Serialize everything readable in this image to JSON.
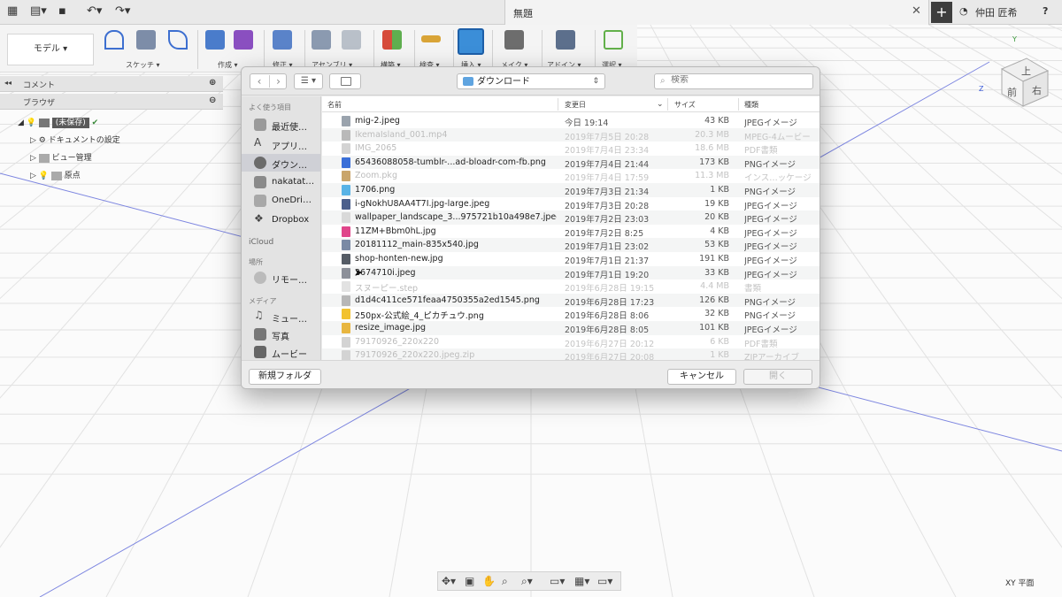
{
  "titlebar": {
    "doc_title": "無題",
    "user": "仲田 匠希",
    "plus": "+",
    "help": "?",
    "close": "✕"
  },
  "toolbar": {
    "model_label": "モデル ▾",
    "groups": [
      {
        "label": "スケッチ ▾"
      },
      {
        "label": "作成 ▾"
      },
      {
        "label": "修正 ▾"
      },
      {
        "label": "アセンブリ ▾"
      },
      {
        "label": "構築 ▾"
      },
      {
        "label": "検査 ▾"
      },
      {
        "label": "挿入 ▾"
      },
      {
        "label": "メイク ▾"
      },
      {
        "label": "アドイン ▾"
      },
      {
        "label": "選択 ▾"
      }
    ]
  },
  "panel": {
    "comments": "コメント",
    "browser": "ブラウザ",
    "tree": {
      "root": "(未保存)",
      "doc_settings": "ドキュメントの設定",
      "named_views": "ビュー管理",
      "origin": "原点"
    }
  },
  "viewport": {
    "plane_label": "XY 平面",
    "cube_top": "上",
    "cube_front": "前",
    "cube_right": "右"
  },
  "dialog": {
    "location": "ダウンロード",
    "search_placeholder": "検索",
    "view_mode": "☰ ▾",
    "sidebar": {
      "favorites_header": "よく使う項目",
      "favorites": [
        {
          "label": "最近使…",
          "selected": false
        },
        {
          "label": "アプリ…",
          "selected": false
        },
        {
          "label": "ダウン…",
          "selected": true
        },
        {
          "label": "nakatat…",
          "selected": false
        },
        {
          "label": "OneDri…",
          "selected": false
        },
        {
          "label": "Dropbox",
          "selected": false
        }
      ],
      "icloud_header": "iCloud",
      "locations_header": "場所",
      "locations": [
        {
          "label": "リモー…"
        }
      ],
      "media_header": "メディア",
      "media": [
        {
          "label": "ミュー…"
        },
        {
          "label": "写真"
        },
        {
          "label": "ムービー"
        }
      ]
    },
    "columns": {
      "name": "名前",
      "date": "変更日",
      "size": "サイズ",
      "kind": "種類"
    },
    "files": [
      {
        "name": "mig-2.jpeg",
        "date": "今日 19:14",
        "size": "43 KB",
        "kind": "JPEGイメージ",
        "dim": false,
        "icon": "#9aa3ad"
      },
      {
        "name": "IkemaIsland_001.mp4",
        "date": "2019年7月5日 20:28",
        "size": "20.3 MB",
        "kind": "MPEG-4ムービー",
        "dim": true,
        "icon": "#b9b9b9"
      },
      {
        "name": "IMG_2065",
        "date": "2019年7月4日 23:34",
        "size": "18.6 MB",
        "kind": "PDF書類",
        "dim": true,
        "icon": "#d3d3d3"
      },
      {
        "name": "65436088058-tumblr-...ad-bloadr-com-fb.png",
        "date": "2019年7月4日 21:44",
        "size": "173 KB",
        "kind": "PNGイメージ",
        "dim": false,
        "icon": "#3a6fd8"
      },
      {
        "name": "Zoom.pkg",
        "date": "2019年7月4日 17:59",
        "size": "11.3 MB",
        "kind": "インス…ッケージ",
        "dim": true,
        "icon": "#c9a56b"
      },
      {
        "name": "1706.png",
        "date": "2019年7月3日 21:34",
        "size": "1 KB",
        "kind": "PNGイメージ",
        "dim": false,
        "icon": "#59b3e6"
      },
      {
        "name": "i-gNokhU8AA4T7I.jpg-large.jpeg",
        "date": "2019年7月3日 20:28",
        "size": "19 KB",
        "kind": "JPEGイメージ",
        "dim": false,
        "icon": "#4b5f8c"
      },
      {
        "name": "wallpaper_landscape_3...975721b10a498e7.jpeg",
        "date": "2019年7月2日 23:03",
        "size": "20 KB",
        "kind": "JPEGイメージ",
        "dim": false,
        "icon": "#d9d9d9"
      },
      {
        "name": "11ZM+Bbm0hL.jpg",
        "date": "2019年7月2日 8:25",
        "size": "4 KB",
        "kind": "JPEGイメージ",
        "dim": false,
        "icon": "#e0458a"
      },
      {
        "name": "20181112_main-835x540.jpg",
        "date": "2019年7月1日 23:02",
        "size": "53 KB",
        "kind": "JPEGイメージ",
        "dim": false,
        "icon": "#7a8aa5"
      },
      {
        "name": "shop-honten-new.jpg",
        "date": "2019年7月1日 21:37",
        "size": "191 KB",
        "kind": "JPEGイメージ",
        "dim": false,
        "icon": "#555c66"
      },
      {
        "name": "2674710i.jpeg",
        "date": "2019年7月1日 19:20",
        "size": "33 KB",
        "kind": "JPEGイメージ",
        "dim": false,
        "icon": "#8c9099"
      },
      {
        "name": "スヌーピー.step",
        "date": "2019年6月28日 19:15",
        "size": "4.4 MB",
        "kind": "書類",
        "dim": true,
        "icon": "#e2e2e2"
      },
      {
        "name": "d1d4c411ce571feaa4750355a2ed1545.png",
        "date": "2019年6月28日 17:23",
        "size": "126 KB",
        "kind": "PNGイメージ",
        "dim": false,
        "icon": "#b7b7b7"
      },
      {
        "name": "250px-公式絵_4_ピカチュウ.png",
        "date": "2019年6月28日 8:06",
        "size": "32 KB",
        "kind": "PNGイメージ",
        "dim": false,
        "icon": "#f2c230"
      },
      {
        "name": "resize_image.jpg",
        "date": "2019年6月28日 8:05",
        "size": "101 KB",
        "kind": "JPEGイメージ",
        "dim": false,
        "icon": "#e8b640"
      },
      {
        "name": "79170926_220x220",
        "date": "2019年6月27日 20:12",
        "size": "6 KB",
        "kind": "PDF書類",
        "dim": true,
        "icon": "#d3d3d3"
      },
      {
        "name": "79170926_220x220.jpeg.zip",
        "date": "2019年6月27日 20:08",
        "size": "1 KB",
        "kind": "ZIPアーカイブ",
        "dim": true,
        "icon": "#d3d3d3"
      }
    ],
    "buttons": {
      "new_folder": "新規フォルダ",
      "cancel": "キャンセル",
      "open": "開く"
    }
  }
}
